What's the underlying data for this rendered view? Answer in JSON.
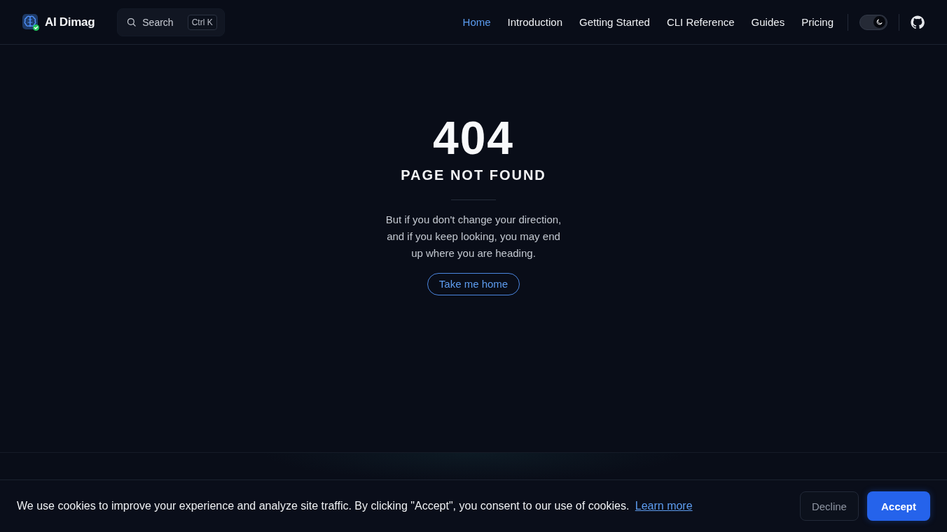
{
  "header": {
    "logo": {
      "title": "AI Dimag"
    },
    "search": {
      "label": "Search",
      "shortcut": "Ctrl K"
    },
    "nav": [
      {
        "label": "Home",
        "selected": true
      },
      {
        "label": "Introduction",
        "selected": false
      },
      {
        "label": "Getting Started",
        "selected": false
      },
      {
        "label": "CLI Reference",
        "selected": false
      },
      {
        "label": "Guides",
        "selected": false
      },
      {
        "label": "Pricing",
        "selected": false
      }
    ],
    "theme_toggle": {
      "dark": true
    }
  },
  "main": {
    "code": "404",
    "title": "PAGE NOT FOUND",
    "message": "But if you don't change your direction, and if you keep looking, you may end up where you are heading.",
    "button": "Take me home"
  },
  "cookie_banner": {
    "message": "We use cookies to improve your experience and analyze site traffic. By clicking \"Accept\", you consent to our use of cookies.",
    "link": "Learn more",
    "buttons": [
      {
        "label": "Decline",
        "kind": "secondary"
      },
      {
        "label": "Accept",
        "kind": "primary"
      }
    ]
  }
}
